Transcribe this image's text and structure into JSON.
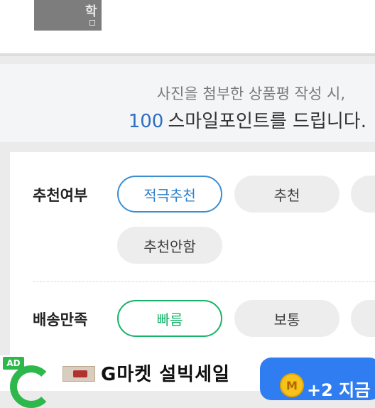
{
  "product_thumb": {
    "glyph": "학"
  },
  "notice": {
    "line1": "사진을 첨부한 상품평 작성 시,",
    "points": "100",
    "line2": "스마일포인트를 드립니다."
  },
  "recommend": {
    "label": "추천여부",
    "options": [
      "적극추천",
      "추천",
      "",
      "추천안함"
    ],
    "selected": "적극추천",
    "selected_color": "#3b8fd3"
  },
  "delivery": {
    "label": "배송만족",
    "options": [
      "빠름",
      "보통",
      ""
    ],
    "selected": "빠름",
    "selected_color": "#17b368"
  },
  "ad": {
    "badge": "AD",
    "logo_icon": "gmarket-g-icon",
    "title": "G마켓 설빅세일",
    "coin_letter": "M",
    "cta": "+2 지금"
  }
}
